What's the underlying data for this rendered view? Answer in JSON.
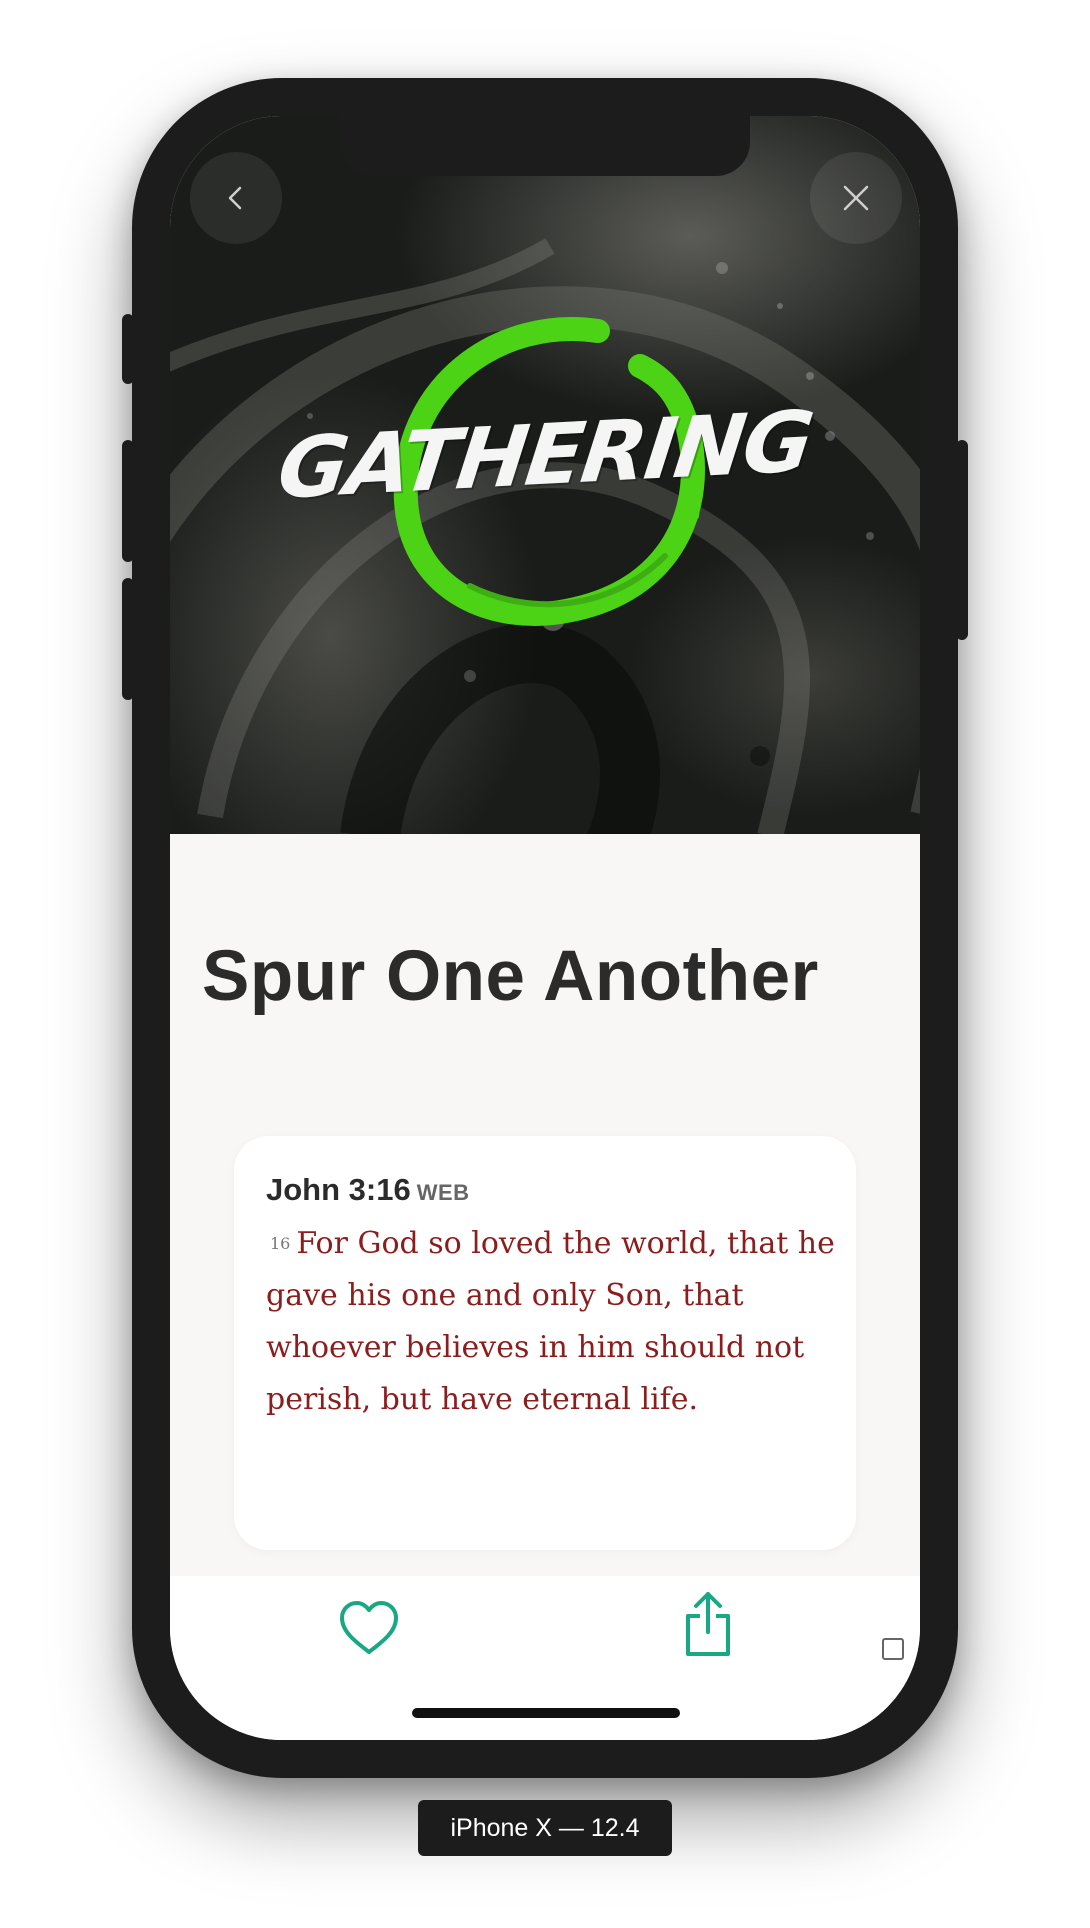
{
  "hero": {
    "logo_text": "GATHERING",
    "accent_color": "#4cd316",
    "back_icon": "chevron-left-icon",
    "close_icon": "close-icon"
  },
  "content": {
    "title": "Spur One Another",
    "scripture": {
      "reference": "John 3:16",
      "version": "WEB",
      "verse_number": "16",
      "text": "For God so loved the world, that he gave his one and only Son, that whoever believes in him should not perish, but have eternal life.",
      "text_color": "#8b1d1d"
    }
  },
  "toolbar": {
    "like_icon": "heart-icon",
    "share_icon": "share-icon",
    "icon_color": "#1aa784"
  },
  "simulator": {
    "label": "iPhone X — 12.4"
  }
}
